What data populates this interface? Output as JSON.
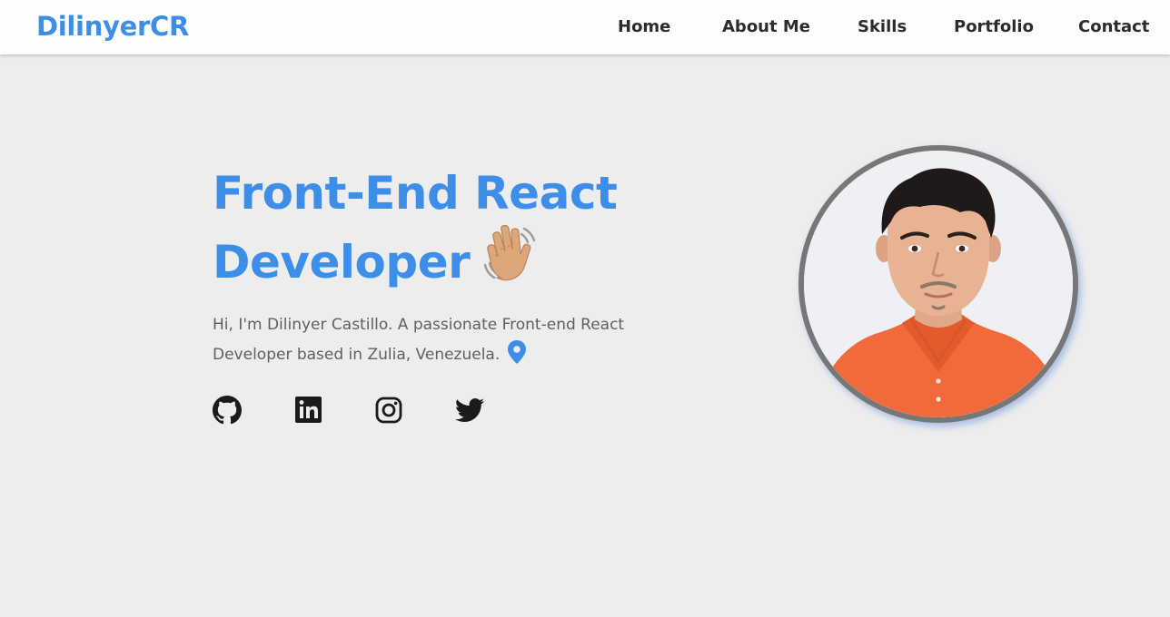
{
  "navbar": {
    "logo": "DilinyerCR",
    "links": [
      "Home",
      "About Me",
      "Skills",
      "Portfolio",
      "Contact"
    ]
  },
  "hero": {
    "title_line1": "Front-End React",
    "title_line2": "Developer",
    "title_emoji_icon": "waving-hand-icon",
    "description": "Hi, I'm Dilinyer Castillo. A passionate Front-end React Developer based in Zulia, Venezuela.",
    "location_icon": "map-pin-icon",
    "socials": [
      "github-icon",
      "linkedin-icon",
      "instagram-icon",
      "twitter-icon"
    ],
    "avatar": "profile-photo"
  },
  "colors": {
    "accent": "#3d8ee8",
    "background": "#ededed",
    "navbar": "#fdfdfd",
    "text_dark": "#2c2c2c",
    "text_muted": "#5f5f5f",
    "avatar_border": "#777777"
  }
}
